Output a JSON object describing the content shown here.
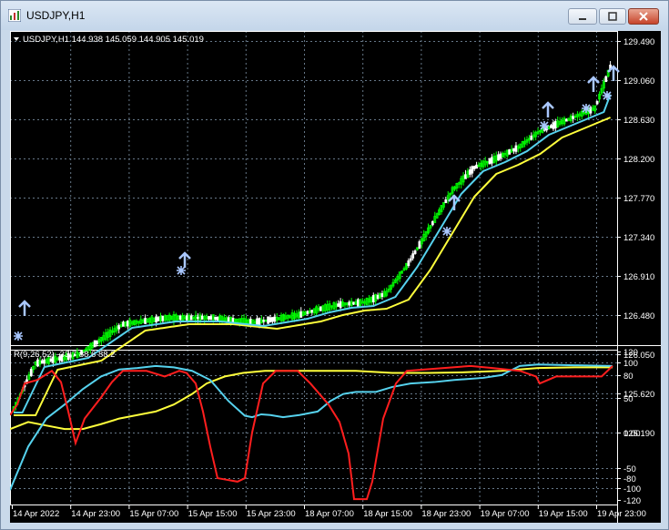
{
  "window": {
    "title": "USDJPY,H1"
  },
  "main_panel": {
    "header": "USDJPY,H1  144.938 145.059 144.905 145.019",
    "price_labels": [
      "129.490",
      "129.060",
      "128.630",
      "128.200",
      "127.770",
      "127.340",
      "126.910",
      "126.480",
      "126.050",
      "125.620",
      "125.190"
    ]
  },
  "indicator_panel": {
    "header": "R(9,26,52) -33.7 88.6 88.2",
    "scale_labels": [
      "120",
      "100",
      "80",
      "50",
      "0.00",
      "-50",
      "-80",
      "-100",
      "-120"
    ]
  },
  "time_axis": [
    "14 Apr 2022",
    "14 Apr 23:00",
    "15 Apr 07:00",
    "15 Apr 15:00",
    "15 Apr 23:00",
    "18 Apr 07:00",
    "18 Apr 15:00",
    "18 Apr 23:00",
    "19 Apr 07:00",
    "19 Apr 15:00",
    "19 Apr 23:00"
  ],
  "colors": {
    "background": "#000000",
    "bull_candle": "#00ff00",
    "bear_candle": "#ffffff",
    "fast_ma": "#56d2ee",
    "slow_ma": "#ffff3c",
    "osc_red": "#ff1e1e",
    "osc_cyan": "#56d2ee",
    "osc_yellow": "#ffff3c",
    "signal_marker": "#a9c7ff",
    "grid": "#667788"
  }
}
